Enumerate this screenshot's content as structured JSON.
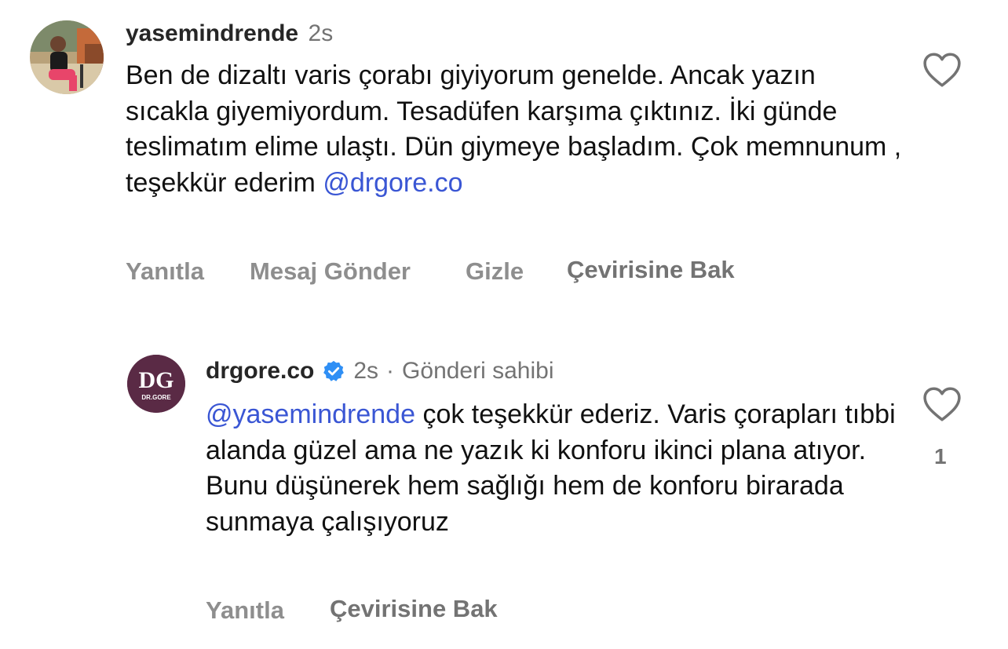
{
  "comments": [
    {
      "username": "yasemindrende",
      "time": "2s",
      "text": "Ben de dizaltı varis çorabı giyiyorum genelde. Ancak yazın sıcakla giyemiyordum. Tesadüfen karşıma çıktınız. İki günde teslimatım elime ulaştı. Dün giymeye başladım. Çok memnunum , teşekkür ederim",
      "mention": "@drgore.co",
      "actions": {
        "reply": "Yanıtla",
        "message": "Mesaj Gönder",
        "hide": "Gizle",
        "translate": "Çevirisine Bak"
      }
    },
    {
      "username": "drgore.co",
      "verified": true,
      "time": "2s",
      "separator": "·",
      "role": "Gönderi sahibi",
      "mention": "@yasemindrende",
      "text": "çok teşekkür ederiz. Varis çorapları tıbbi alanda güzel ama ne yazık ki konforu ikinci plana atıyor. Bunu düşünerek hem sağlığı hem de konforu birarada sunmaya çalışıyoruz",
      "like_count": "1",
      "logo_text": "DG",
      "logo_subtext": "DR.GORE",
      "actions": {
        "reply": "Yanıtla",
        "translate": "Çevirisine Bak"
      }
    }
  ],
  "colors": {
    "mention": "#3a56d4",
    "verified": "#2f8ff5",
    "logo_bg": "#5a2a45"
  }
}
